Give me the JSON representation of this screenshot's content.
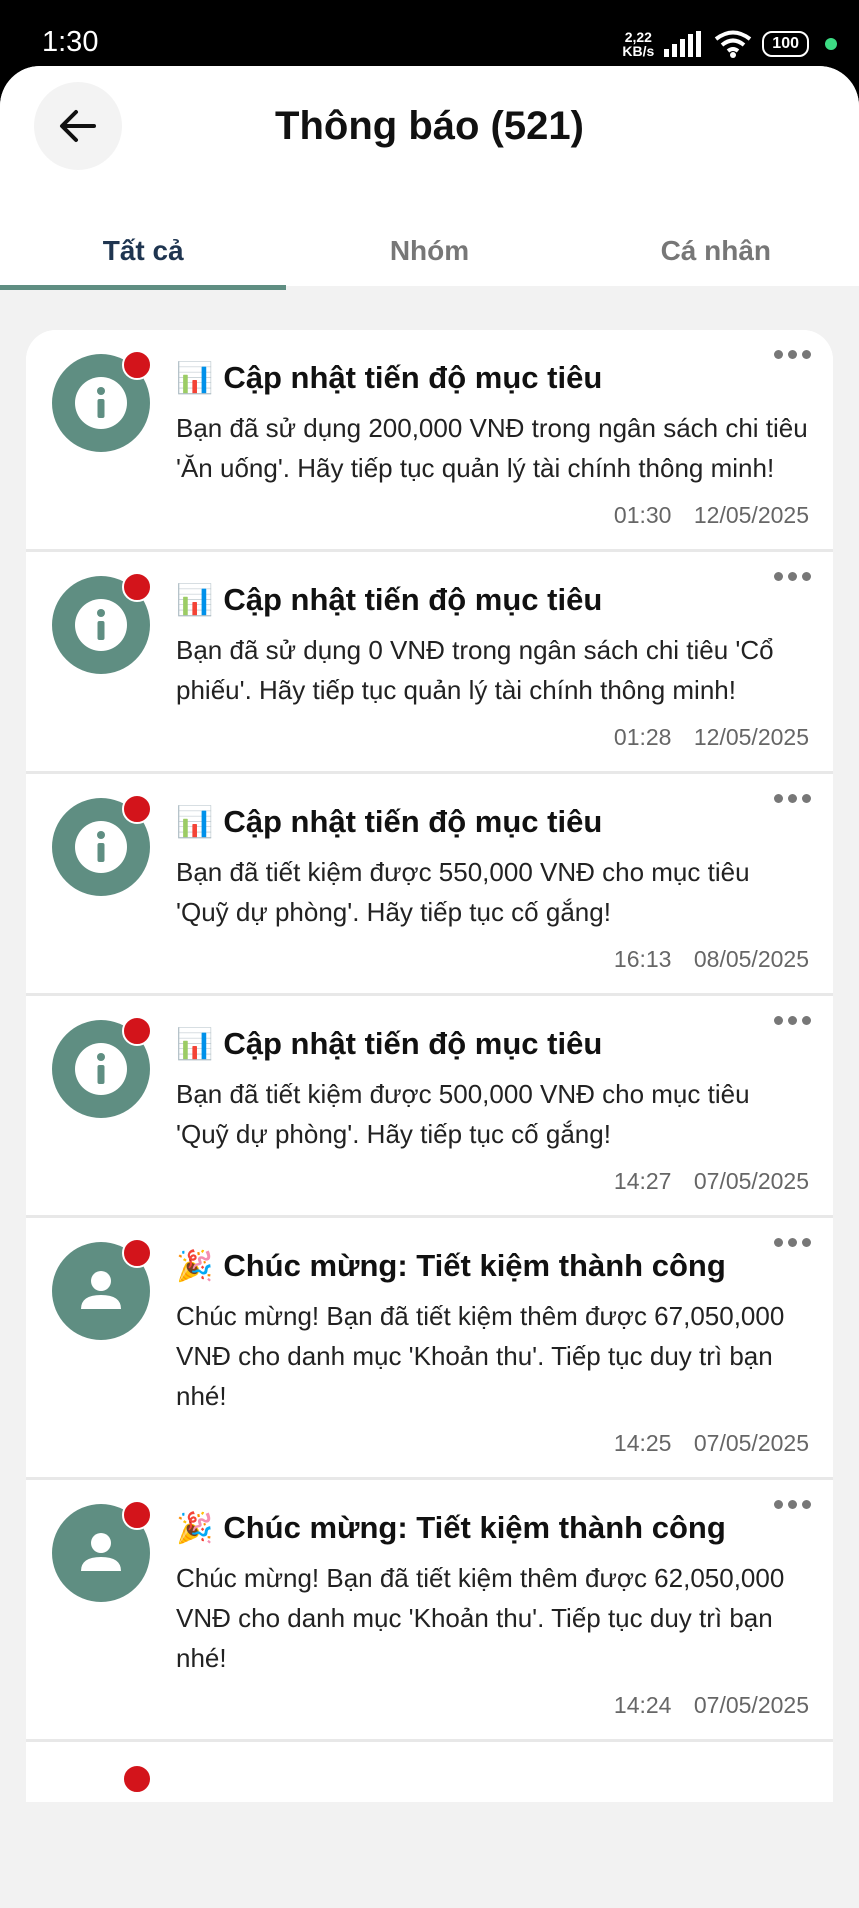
{
  "status": {
    "time": "1:30",
    "speed_value": "2,22",
    "speed_unit": "KB/s",
    "battery": "100"
  },
  "header": {
    "title": "Thông báo (521)"
  },
  "tabs": [
    {
      "label": "Tất cả",
      "active": true
    },
    {
      "label": "Nhóm",
      "active": false
    },
    {
      "label": "Cá nhân",
      "active": false
    }
  ],
  "notifications": [
    {
      "icon": "info-icon",
      "emoji": "📊",
      "title": "Cập nhật tiến độ mục tiêu",
      "body": "Bạn đã sử dụng 200,000 VNĐ trong ngân sách chi tiêu 'Ăn uống'. Hãy tiếp tục quản lý tài chính thông minh!",
      "time": "01:30",
      "date": "12/05/2025"
    },
    {
      "icon": "info-icon",
      "emoji": "📊",
      "title": "Cập nhật tiến độ mục tiêu",
      "body": "Bạn đã sử dụng 0 VNĐ trong ngân sách chi tiêu 'Cổ phiếu'. Hãy tiếp tục quản lý tài chính thông minh!",
      "time": "01:28",
      "date": "12/05/2025"
    },
    {
      "icon": "info-icon",
      "emoji": "📊",
      "title": "Cập nhật tiến độ mục tiêu",
      "body": "Bạn đã tiết kiệm được 550,000 VNĐ cho mục tiêu 'Quỹ dự phòng'. Hãy tiếp tục cố gắng!",
      "time": "16:13",
      "date": "08/05/2025"
    },
    {
      "icon": "info-icon",
      "emoji": "📊",
      "title": "Cập nhật tiến độ mục tiêu",
      "body": "Bạn đã tiết kiệm được 500,000 VNĐ cho mục tiêu 'Quỹ dự phòng'. Hãy tiếp tục cố gắng!",
      "time": "14:27",
      "date": "07/05/2025"
    },
    {
      "icon": "person-icon",
      "emoji": "🎉",
      "title": "Chúc mừng: Tiết kiệm thành công",
      "body": "Chúc mừng! Bạn đã tiết kiệm thêm được 67,050,000 VNĐ cho danh mục 'Khoản thu'. Tiếp tục duy trì bạn nhé!",
      "time": "14:25",
      "date": "07/05/2025"
    },
    {
      "icon": "person-icon",
      "emoji": "🎉",
      "title": "Chúc mừng: Tiết kiệm thành công",
      "body": "Chúc mừng! Bạn đã tiết kiệm thêm được 62,050,000 VNĐ cho danh mục 'Khoản thu'. Tiếp tục duy trì bạn nhé!",
      "time": "14:24",
      "date": "07/05/2025"
    }
  ]
}
